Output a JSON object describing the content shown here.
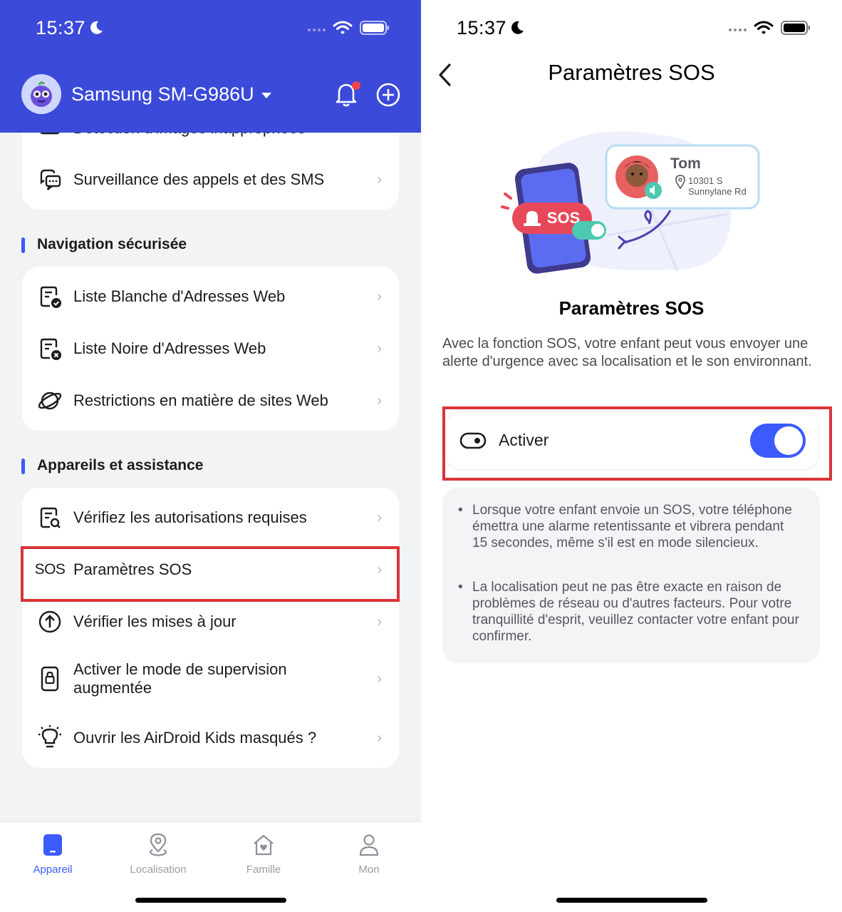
{
  "left": {
    "status": {
      "time": "15:37"
    },
    "header": {
      "device_name": "Samsung SM-G986U"
    },
    "top_card": {
      "partial_label": "Détection d'images inappropriées",
      "items": [
        {
          "label": "Surveillance des appels et des SMS",
          "icon": "chat-bubble-icon"
        }
      ]
    },
    "sections": [
      {
        "title": "Navigation sécurisée",
        "items": [
          {
            "label": "Liste Blanche d'Adresses Web",
            "icon": "whitelist-icon"
          },
          {
            "label": "Liste Noire d'Adresses Web",
            "icon": "blacklist-icon"
          },
          {
            "label": "Restrictions en matière de sites Web",
            "icon": "planet-icon"
          }
        ]
      },
      {
        "title": "Appareils et assistance",
        "items": [
          {
            "label": "Vérifiez les autorisations requises",
            "icon": "doc-search-icon"
          },
          {
            "label": "Paramètres SOS",
            "icon_text": "SOS"
          },
          {
            "label": "Vérifier les mises à jour",
            "icon": "arrow-up-circle-icon"
          },
          {
            "label": "Activer le mode de supervision augmentée",
            "icon": "lock-phone-icon"
          },
          {
            "label": "Ouvrir les AirDroid Kids masqués ?",
            "icon": "bulb-icon"
          }
        ]
      }
    ],
    "tabs": [
      {
        "label": "Appareil",
        "active": true
      },
      {
        "label": "Localisation",
        "active": false
      },
      {
        "label": "Famille",
        "active": false
      },
      {
        "label": "Mon",
        "active": false
      }
    ],
    "colors": {
      "header": "#3b4ad9",
      "accent": "#3b5bfd",
      "highlight": "#d9343a"
    }
  },
  "right": {
    "status": {
      "time": "15:37"
    },
    "nav_title": "Paramètres SOS",
    "illustration": {
      "contact_name": "Tom",
      "address_line1": "10301 S",
      "address_line2": "Sunnylane Rd",
      "badge": "SOS"
    },
    "title": "Paramètres SOS",
    "description": "Avec la fonction SOS, votre enfant peut vous envoyer une alerte d'urgence avec sa localisation et le son environnant.",
    "toggle": {
      "label": "Activer",
      "on": true
    },
    "notes": [
      "Lorsque votre enfant envoie un SOS, votre téléphone émettra une alarme retentissante et vibrera pendant 15 secondes, même s'il est en mode silencieux.",
      "La localisation peut ne pas être exacte en raison de problèmes de réseau ou d'autres facteurs. Pour votre tranquillité d'esprit, veuillez contacter votre enfant pour confirmer."
    ]
  }
}
